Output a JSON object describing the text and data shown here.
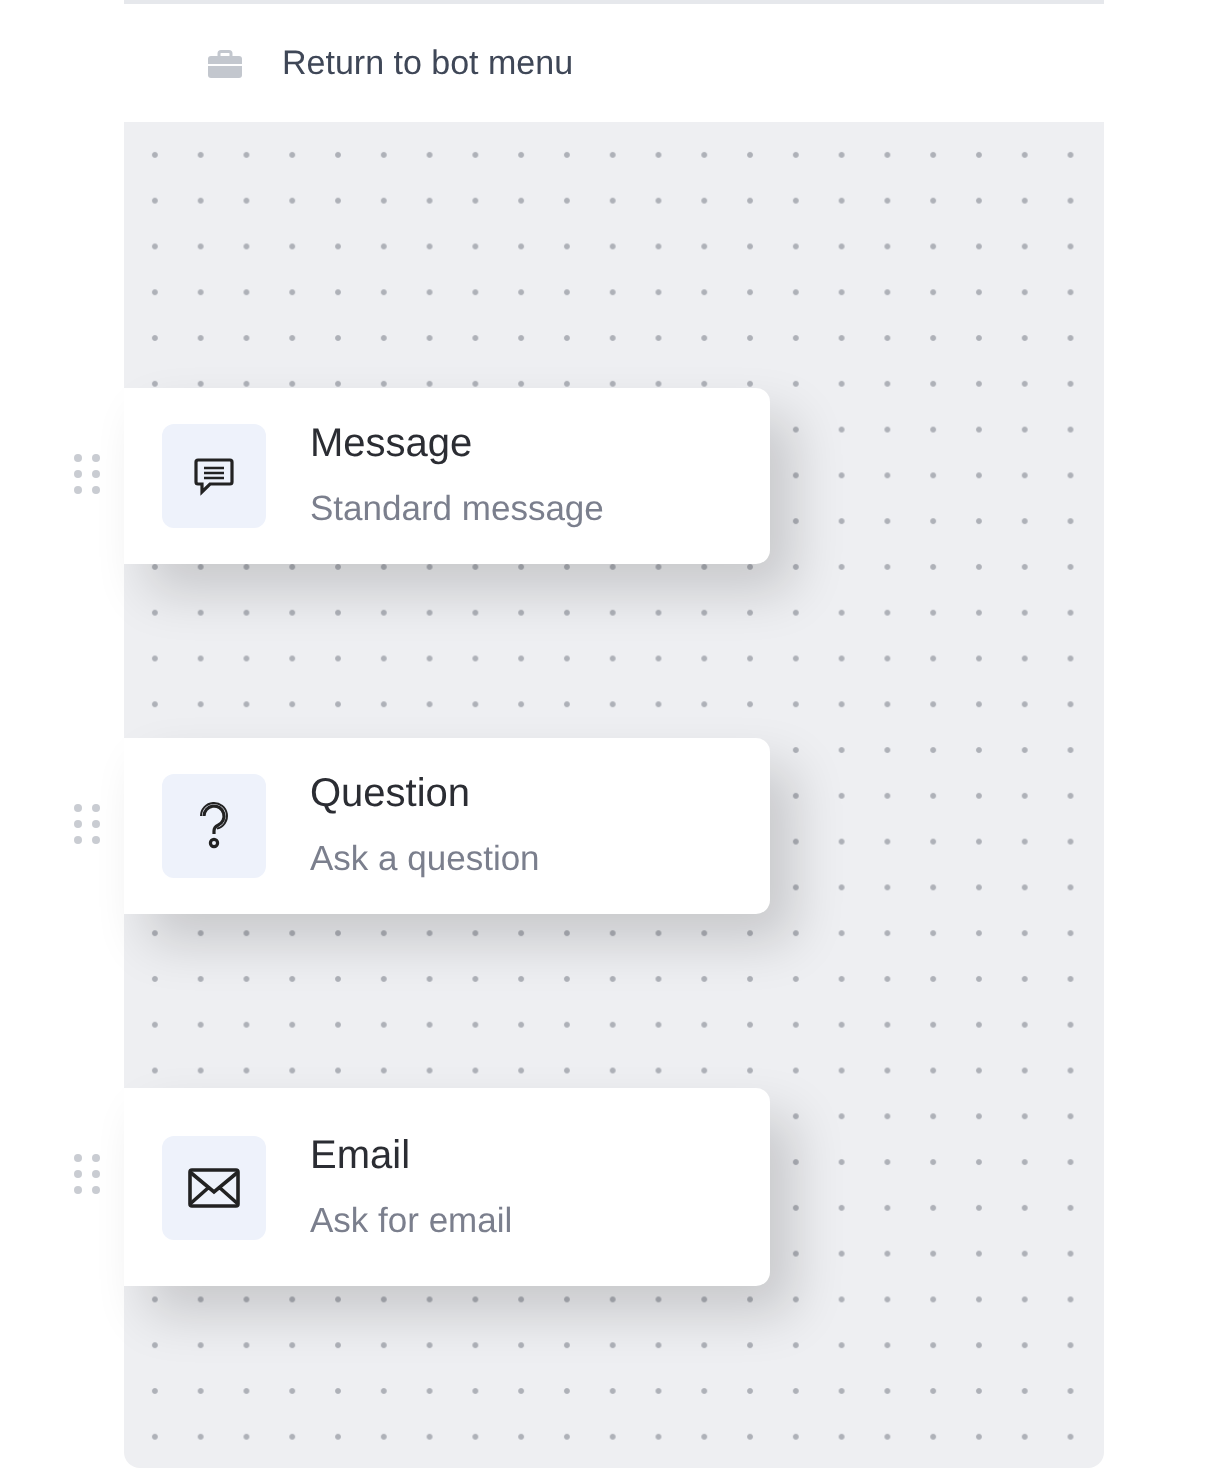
{
  "return_link": {
    "label": "Return to bot menu"
  },
  "blocks": [
    {
      "kind": "message",
      "title": "Message",
      "subtitle": "Standard message"
    },
    {
      "kind": "question",
      "title": "Question",
      "subtitle": "Ask a question"
    },
    {
      "kind": "email",
      "title": "Email",
      "subtitle": "Ask for email"
    }
  ]
}
